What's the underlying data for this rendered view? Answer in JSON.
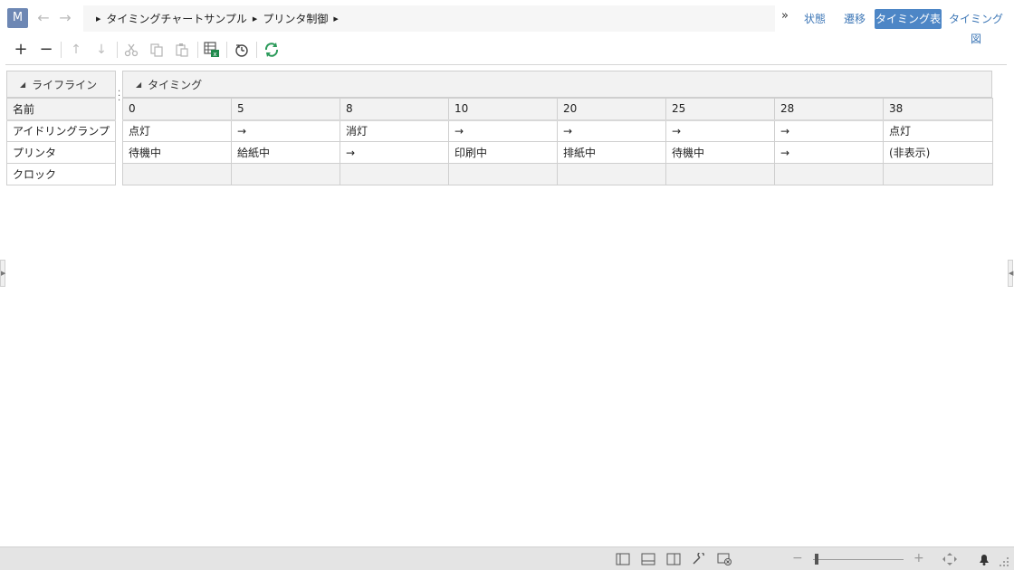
{
  "app": {
    "icon_letter": "M"
  },
  "breadcrumb": {
    "items": [
      "タイミングチャートサンプル",
      "プリンタ制御"
    ]
  },
  "views": {
    "more": "»",
    "tabs": [
      {
        "label": "状態",
        "active": false
      },
      {
        "label": "遷移",
        "active": false
      },
      {
        "label": "タイミング表",
        "active": true
      },
      {
        "label": "タイミング図",
        "active": false
      }
    ]
  },
  "toolbar": {
    "add": "+",
    "remove": "−",
    "move_up": "↑",
    "move_down": "↓"
  },
  "lifeline_panel": {
    "title": "ライフライン",
    "name_header": "名前",
    "rows": [
      "アイドリングランプ",
      "プリンタ",
      "クロック"
    ]
  },
  "timing_panel": {
    "title": "タイミング",
    "times": [
      "0",
      "5",
      "8",
      "10",
      "20",
      "25",
      "28",
      "38"
    ],
    "rows": [
      [
        "点灯",
        "→",
        "消灯",
        "→",
        "→",
        "→",
        "→",
        "点灯"
      ],
      [
        "待機中",
        "給紙中",
        "→",
        "印刷中",
        "排紙中",
        "待機中",
        "→",
        "(非表示)"
      ],
      [
        "",
        "",
        "",
        "",
        "",
        "",
        "",
        ""
      ]
    ]
  },
  "colors": {
    "accent": "#4d86c6",
    "link": "#3f78b7",
    "app_icon": "#6d87b4"
  }
}
